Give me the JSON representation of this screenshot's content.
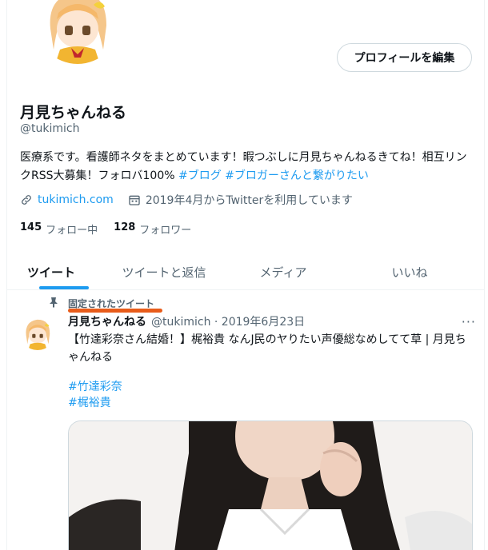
{
  "profile": {
    "edit_button": "プロフィールを編集",
    "name": "月見ちゃんねる",
    "handle": "@tukimich",
    "bio_text": "医療系です。看護師ネタをまとめています！暇つぶしに月見ちゃんねるきてね！相互リンクRSS大募集！フォロバ100% ",
    "bio_tag1": "#ブログ",
    "bio_tag2": "#ブロガーさんと繋がりたい",
    "link": "tukimich.com",
    "joined": "2019年4月からTwitterを利用しています",
    "following_count": "145",
    "following_label": "フォロー中",
    "followers_count": "128",
    "followers_label": "フォロワー"
  },
  "tabs": [
    {
      "label": "ツイート"
    },
    {
      "label": "ツイートと返信"
    },
    {
      "label": "メディア"
    },
    {
      "label": "いいね"
    }
  ],
  "tweet": {
    "pinned_label": "固定されたツイート",
    "author": "月見ちゃんねる",
    "meta": "@tukimich · 2019年6月23日",
    "more": "···",
    "body": "【竹達彩奈さん結婚！】梶裕貴 なんJ民のヤりたい声優総なめしてて草 | 月見ちゃんねる",
    "tags": [
      "#竹達彩奈",
      "#梶裕貴"
    ]
  },
  "colors": {
    "accent": "#1d9bf0",
    "underline_mark": "#e85c1a",
    "secondary_text": "#536471"
  },
  "icons": [
    "link-icon",
    "calendar-icon",
    "pin-icon",
    "more-icon"
  ]
}
